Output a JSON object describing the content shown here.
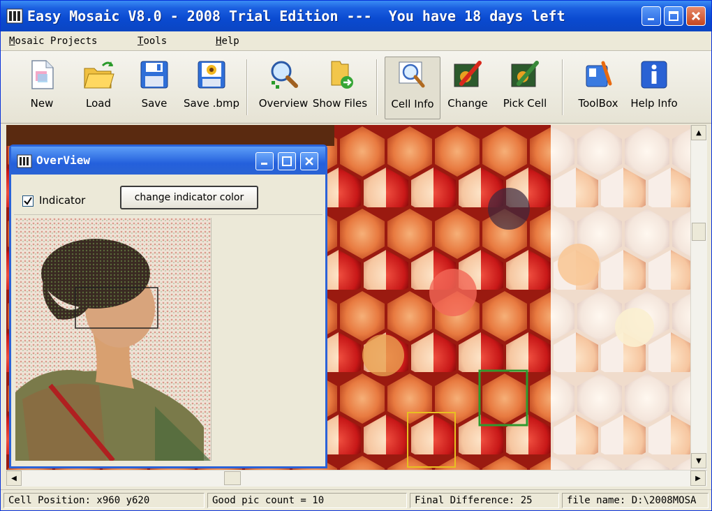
{
  "window": {
    "title": "Easy Mosaic V8.0 - 2008 Trial Edition ---  You have 18 days left"
  },
  "menu": [
    "Mosaic Projects",
    "Tools",
    "Help"
  ],
  "toolbar": [
    {
      "label": "New",
      "icon": "new-file-icon"
    },
    {
      "label": "Load",
      "icon": "open-folder-icon"
    },
    {
      "label": "Save",
      "icon": "floppy-disk-icon"
    },
    {
      "label": "Save .bmp",
      "icon": "floppy-flower-icon"
    },
    {
      "label": "Overview",
      "icon": "magnifier-icon"
    },
    {
      "label": "Show Files",
      "icon": "folder-arrow-icon"
    },
    {
      "label": "Cell Info",
      "icon": "cell-info-icon",
      "pressed": true
    },
    {
      "label": "Change",
      "icon": "pencil-flower-icon"
    },
    {
      "label": "Pick Cell",
      "icon": "pencil-pick-icon"
    },
    {
      "label": "ToolBox",
      "icon": "toolbox-icon"
    },
    {
      "label": "Help Info",
      "icon": "info-icon"
    }
  ],
  "overview": {
    "title": "OverView",
    "indicator_label": "Indicator",
    "indicator_checked": true,
    "change_color_button": "change indicator color"
  },
  "status": {
    "cell_position": "Cell Position: x960 y620",
    "good_pic_count": "Good pic count = 10",
    "final_difference": "Final Difference: 25",
    "file_name": "file name: D:\\2008MOSA"
  },
  "colors": {
    "title_blue": "#0a4ad0",
    "chrome": "#ece9d8",
    "indicator_highlight": "#2f9a2f",
    "selected_cell": "#e8c020"
  }
}
